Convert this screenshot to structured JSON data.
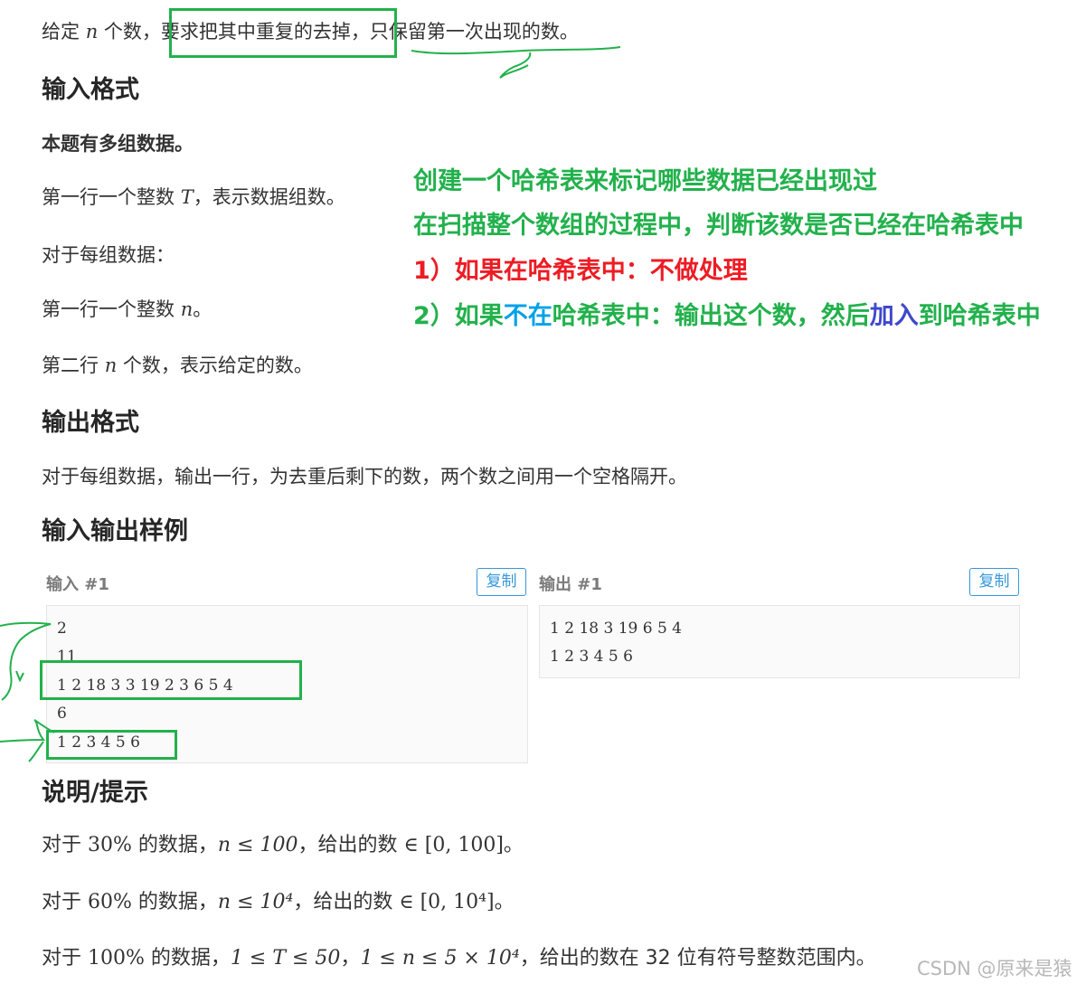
{
  "statement": {
    "p1_before": "给定 ",
    "p1_var": "n",
    "p1_mid": " 个数，",
    "p1_boxed": "要求把其中重复的去掉",
    "p1_after": "，只保留第一次出现的数。"
  },
  "input_format": {
    "heading": "输入格式",
    "line1": "本题有多组数据。",
    "line2_before": "第一行一个整数 ",
    "line2_var": "T",
    "line2_after": "，表示数据组数。",
    "line3": "对于每组数据：",
    "line4_before": "第一行一个整数 ",
    "line4_var": "n",
    "line4_after": "。",
    "line5_before": "第二行 ",
    "line5_var": "n",
    "line5_after": " 个数，表示给定的数。"
  },
  "output_format": {
    "heading": "输出格式",
    "line1": "对于每组数据，输出一行，为去重后剩下的数，两个数之间用一个空格隔开。"
  },
  "samples": {
    "heading": "输入输出样例",
    "input_title": "输入 #1",
    "output_title": "输出 #1",
    "copy_label": "复制",
    "input_lines": [
      "2",
      "11",
      "1 2 18 3 3 19 2 3 6 5 4",
      "6",
      "1 2 3 4 5 6"
    ],
    "output_lines": [
      "1 2 18 3 19 6 5 4",
      "1 2 3 4 5 6"
    ]
  },
  "hints": {
    "heading": "说明/提示",
    "h1_a": "对于 ",
    "h1_pct": "30%",
    "h1_b": " 的数据，",
    "h1_math": "n ≤ 100",
    "h1_c": "，给出的数 ",
    "h1_range": "∈ [0, 100]",
    "h1_d": "。",
    "h2_a": "对于 ",
    "h2_pct": "60%",
    "h2_b": " 的数据，",
    "h2_math": "n ≤ 10⁴",
    "h2_c": "，给出的数 ",
    "h2_range": "∈ [0, 10⁴]",
    "h2_d": "。",
    "h3_a": "对于 ",
    "h3_pct": "100%",
    "h3_b": " 的数据，",
    "h3_math1": "1 ≤ T ≤ 50",
    "h3_sep": "，",
    "h3_math2": "1 ≤ n ≤ 5 × 10⁴",
    "h3_c": "，给出的数在 32 位有符号整数范围内。"
  },
  "annotations": {
    "line1": "创建一个哈希表来标记哪些数据已经出现过",
    "line2": "在扫描整个数组的过程中，判断该数是否已经在哈希表中",
    "line3": "1）如果在哈希表中：不做处理",
    "line4_a": "2）如果",
    "line4_b": "不在",
    "line4_c": "哈希表中：输出这个数，然后",
    "line4_d": "加入",
    "line4_e": "到哈希表中"
  },
  "watermark": "CSDN @原来是猿",
  "colors": {
    "annotation_green": "#22b14c",
    "annotation_red": "#ed1c24",
    "annotation_cyan": "#00a2e8",
    "annotation_blue": "#3f48cc",
    "button_blue": "#3498db"
  }
}
